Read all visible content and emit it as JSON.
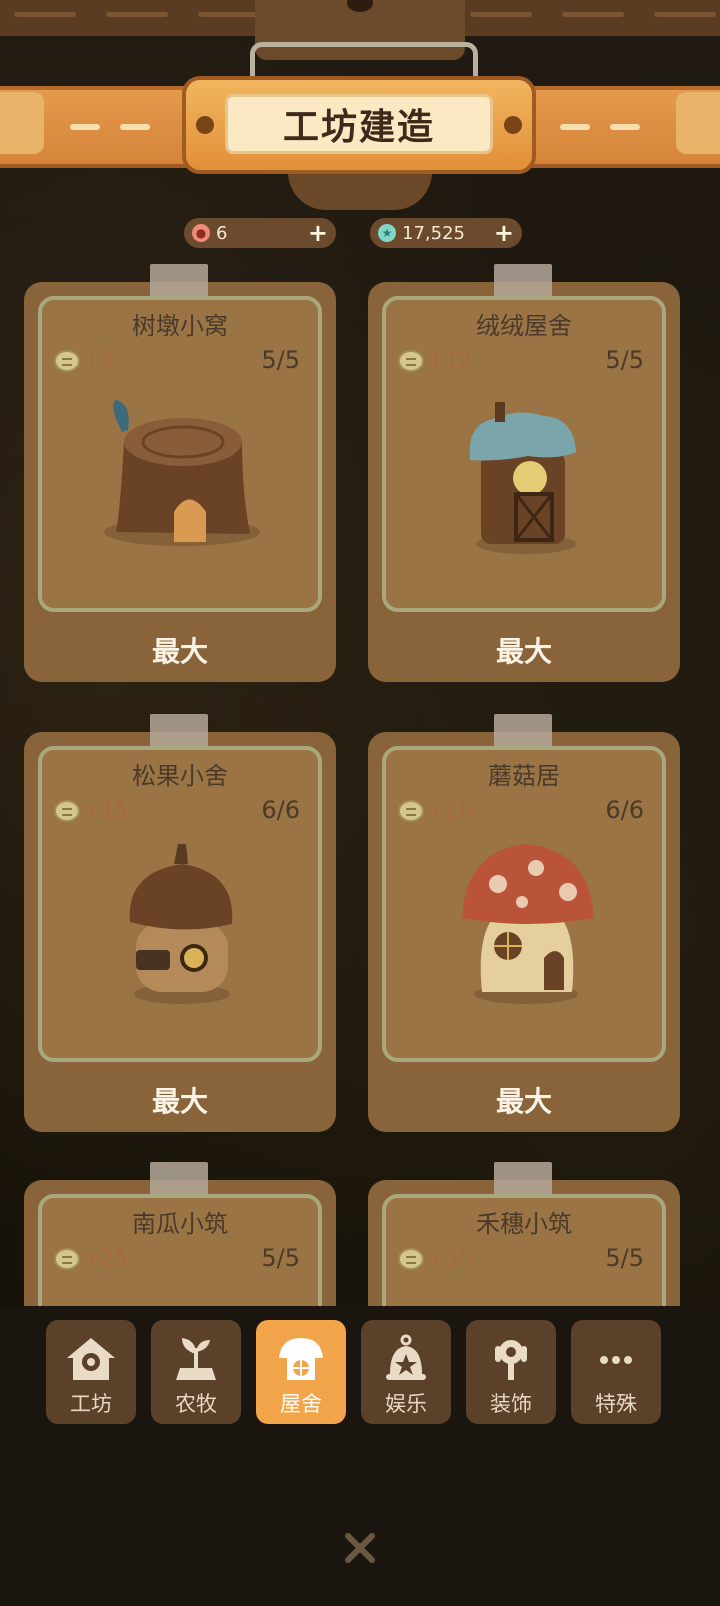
{
  "header": {
    "title": "工坊建造"
  },
  "currencies": [
    {
      "icon": "seal-coin-icon",
      "value": "6"
    },
    {
      "icon": "star-gem-icon",
      "value": "17,525"
    }
  ],
  "cards": [
    {
      "name": "树墩小窝",
      "bonus": "+5",
      "count": "5/5",
      "status": "最大",
      "art": "tree-stump-house"
    },
    {
      "name": "绒绒屋舍",
      "bonus": "+12",
      "count": "5/5",
      "status": "最大",
      "art": "fluffy-roof-house"
    },
    {
      "name": "松果小舍",
      "bonus": "+15",
      "count": "6/6",
      "status": "最大",
      "art": "acorn-house"
    },
    {
      "name": "蘑菇居",
      "bonus": "+20",
      "count": "6/6",
      "status": "最大",
      "art": "mushroom-house"
    },
    {
      "name": "南瓜小筑",
      "bonus": "+25",
      "count": "5/5",
      "art": "pumpkin-house"
    },
    {
      "name": "禾穗小筑",
      "bonus": "+30",
      "count": "5/5",
      "art": "wheat-house"
    }
  ],
  "nav": [
    {
      "label": "工坊",
      "icon": "workshop-icon"
    },
    {
      "label": "农牧",
      "icon": "sprout-icon"
    },
    {
      "label": "屋舍",
      "icon": "house-icon",
      "active": true
    },
    {
      "label": "娱乐",
      "icon": "bell-icon"
    },
    {
      "label": "装饰",
      "icon": "decoration-icon"
    },
    {
      "label": "特殊",
      "icon": "more-icon"
    }
  ],
  "close": {
    "icon": "close-icon"
  }
}
